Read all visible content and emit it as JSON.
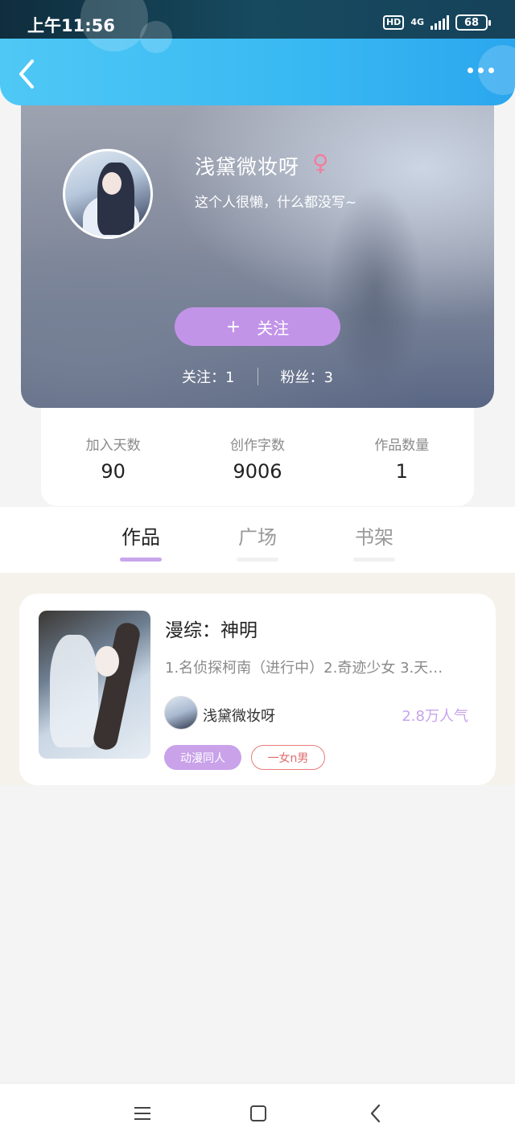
{
  "status_bar": {
    "time": "上午11:56",
    "hd": "HD",
    "network": "4G",
    "battery": "68"
  },
  "header": {
    "back_icon": "chevron-left-icon",
    "more_icon": "more-dots-icon"
  },
  "profile": {
    "username": "浅黛微妆呀",
    "gender_symbol": "♀",
    "bio": "这个人很懒，什么都没写~",
    "follow_plus": "+",
    "follow_label": "关注",
    "following_text": "关注：1",
    "followers_text": "粉丝：3"
  },
  "stats": [
    {
      "label": "加入天数",
      "value": "90"
    },
    {
      "label": "创作字数",
      "value": "9006"
    },
    {
      "label": "作品数量",
      "value": "1"
    }
  ],
  "tabs": [
    {
      "label": "作品",
      "active": true
    },
    {
      "label": "广场",
      "active": false
    },
    {
      "label": "书架",
      "active": false
    }
  ],
  "book": {
    "title": "漫综：神明",
    "description": "1.名侦探柯南（进行中）2.奇迹少女 3.天…",
    "author": "浅黛微妆呀",
    "popularity": "2.8万人气",
    "tags": [
      "动漫同人",
      "一女n男"
    ]
  },
  "colors": {
    "accent": "#c294e8",
    "header_blue": "#38b8f2",
    "popularity": "#c7a3ec",
    "tag_outline": "#e97b7b"
  }
}
